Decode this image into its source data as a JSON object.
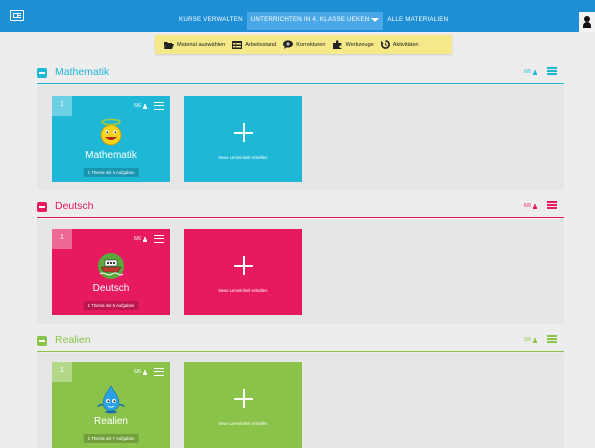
{
  "header": {
    "nav": [
      {
        "label": "KURSE VERWALTEN"
      },
      {
        "label": "UNTERRICHTEN IN 4. KLASSE UEKEN"
      },
      {
        "label": "ALLE MATERIALIEN"
      }
    ],
    "accent_color": "#1e8fd5"
  },
  "toolbar": {
    "items": [
      {
        "label": "Material auswählen",
        "icon": "folder-open-icon"
      },
      {
        "label": "Arbeitsstand",
        "icon": "table-icon"
      },
      {
        "label": "Korrekturen",
        "icon": "comment-icon"
      },
      {
        "label": "Werkzeuge",
        "icon": "puzzle-icon"
      },
      {
        "label": "Aktivitäten",
        "icon": "history-icon"
      }
    ]
  },
  "sections": [
    {
      "title": "Mathematik",
      "color": "#1fb7d6",
      "count": "6/6",
      "card": {
        "number": "1",
        "count": "6/6",
        "title": "Mathematik",
        "info": "1 Thema mit 4 Aufgaben",
        "mascot": "smiley-angel-icon"
      },
      "add_label": "Neue Lerneinheit erstellen"
    },
    {
      "title": "Deutsch",
      "color": "#e71a60",
      "count": "6/6",
      "card": {
        "number": "1",
        "count": "6/6",
        "title": "Deutsch",
        "info": "1 Thema mit 6 Aufgaben",
        "mascot": "boat-icon"
      },
      "add_label": "Neue Lerneinheit erstellen"
    },
    {
      "title": "Realien",
      "color": "#8bc34a",
      "count": "6/6",
      "card": {
        "number": "1",
        "count": "6/6",
        "title": "Realien",
        "info": "1 Thema mit 7 Aufgaben",
        "mascot": "water-drop-icon"
      },
      "add_label": "Neue Lerneinheit erstellen"
    }
  ]
}
